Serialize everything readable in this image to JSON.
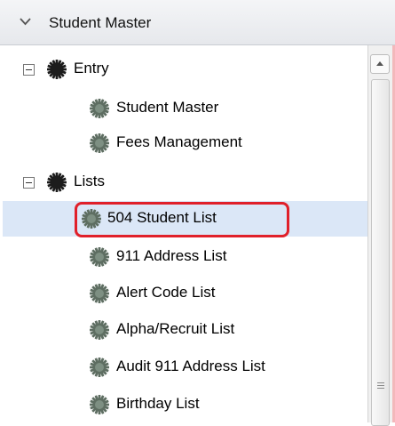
{
  "panel": {
    "title": "Student Master"
  },
  "tree": {
    "groups": [
      {
        "label": "Entry",
        "items": [
          "Student Master",
          "Fees Management"
        ]
      },
      {
        "label": "Lists",
        "items": [
          "504 Student List",
          "911 Address List",
          "Alert Code List",
          "Alpha/Recruit List",
          "Audit 911 Address List",
          "Birthday List"
        ]
      }
    ],
    "selected_item": "504 Student List"
  },
  "colors": {
    "selection": "#dbe7f7",
    "highlight_border": "#e0202a",
    "gear": "#222222"
  },
  "icons": {
    "collapse": "minus-box-icon",
    "folder": "gear-icon",
    "item": "gear-icon"
  }
}
